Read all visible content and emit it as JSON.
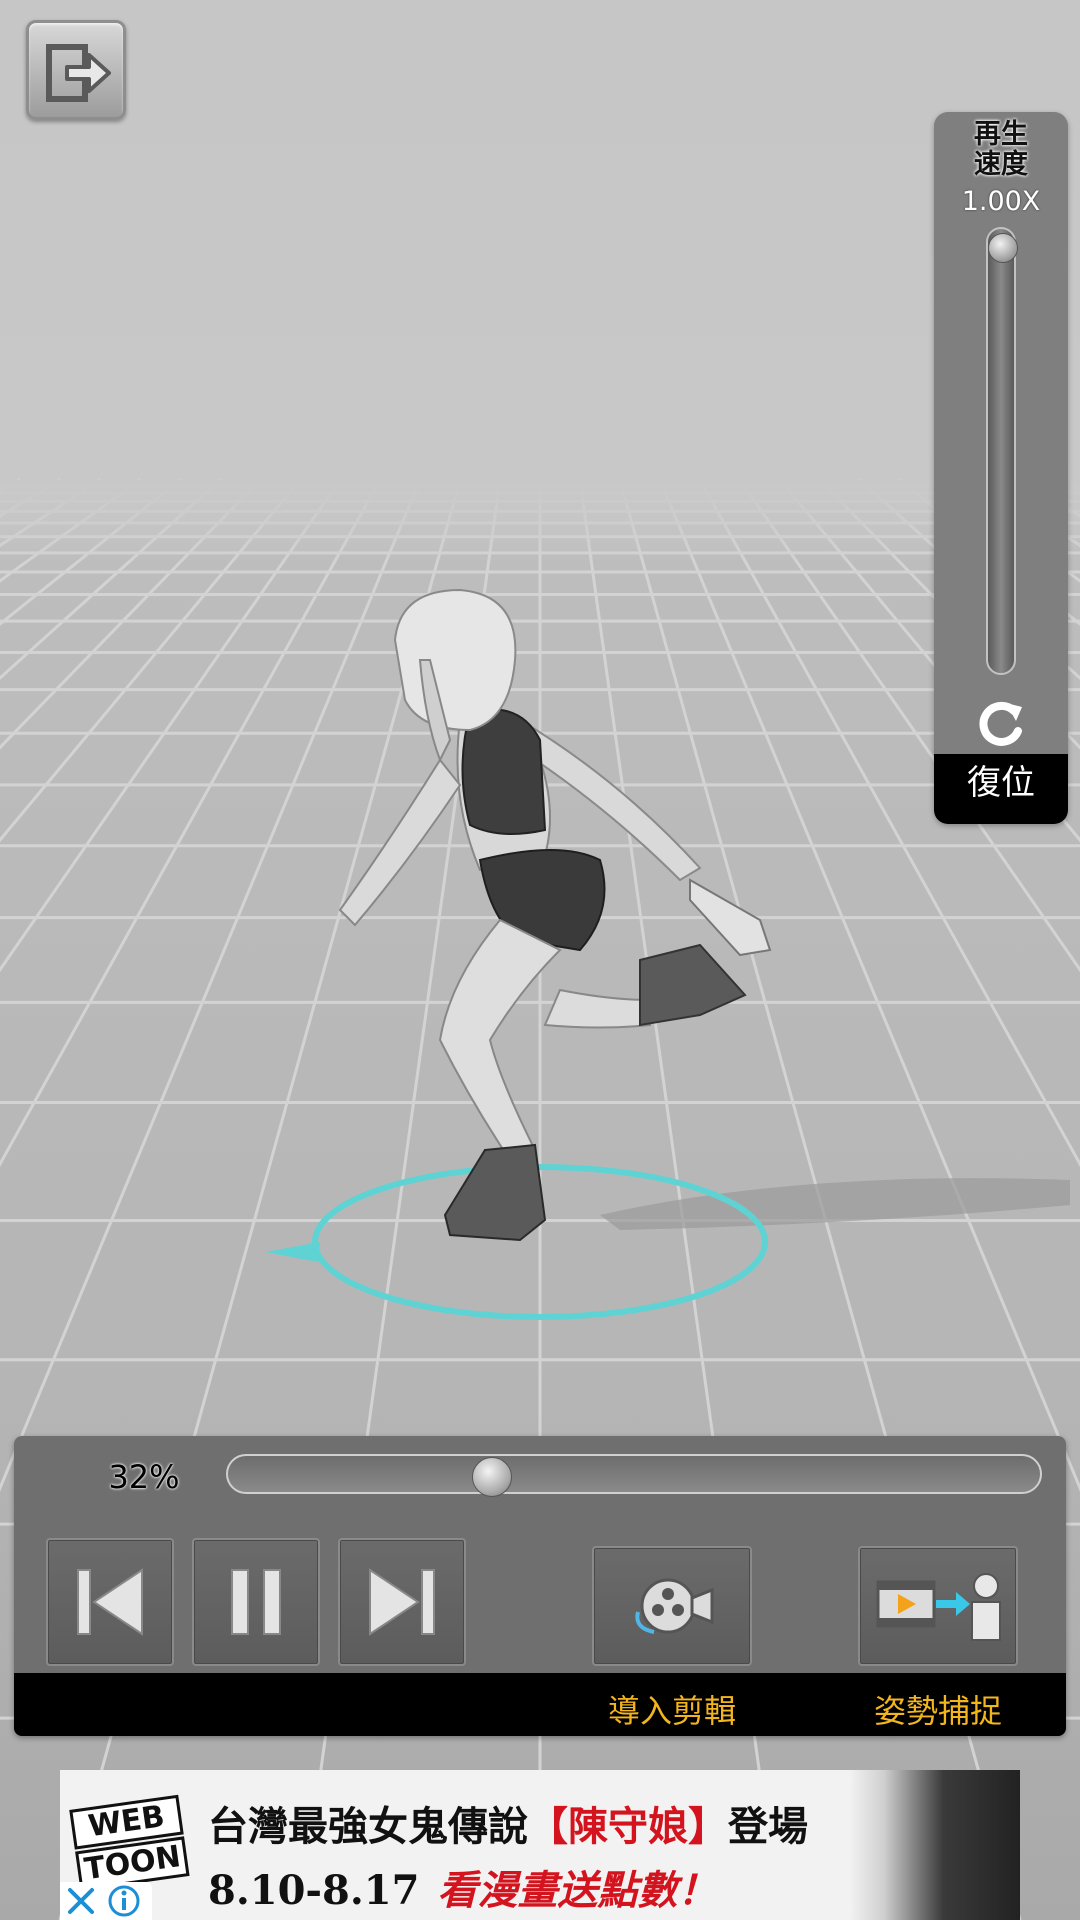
{
  "viewport": {
    "floor_color": "#b4b4b4",
    "grid_color": "#d2d2d2",
    "ring_color": "#5fd3d3"
  },
  "exit_button": {
    "icon": "exit-icon"
  },
  "speed_panel": {
    "title_line1": "再生",
    "title_line2": "速度",
    "value_text": "1.00X",
    "slider_level": 0,
    "reset_icon": "refresh-icon",
    "reset_label": "復位"
  },
  "playback": {
    "percent_text": "32%",
    "progress_fraction": 0.32,
    "buttons": {
      "prev_icon": "skip-to-start-icon",
      "pause_icon": "pause-icon",
      "next_icon": "skip-to-end-icon"
    }
  },
  "actions": {
    "import_clip": {
      "icon": "film-reel-icon",
      "label": "導入剪輯"
    },
    "pose_capture": {
      "icon": "film-to-person-icon",
      "label": "姿勢捕捉"
    }
  },
  "ad": {
    "logo_line1": "WEB",
    "logo_line2": "TOON",
    "headline_pre": "台灣最強女鬼傳說",
    "headline_highlight": "【陳守娘】",
    "headline_post": "登場",
    "dates": "8.10-8.17",
    "cta": "看漫畫送點數！",
    "close_icon": "close-icon",
    "info_icon": "info-icon"
  }
}
